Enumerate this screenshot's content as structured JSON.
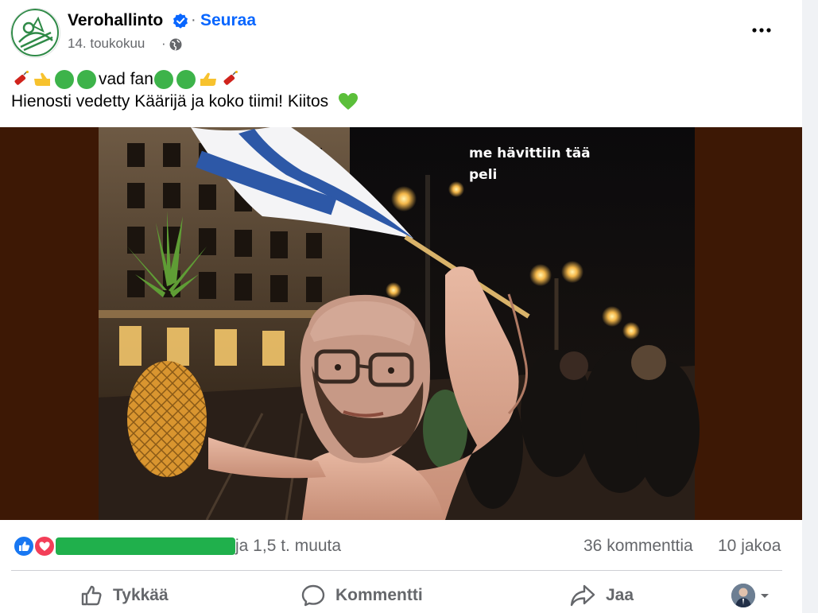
{
  "post": {
    "page_name": "Verohallinto",
    "follow_label": "Seuraa",
    "separator": "·",
    "date": "14. toukokuu",
    "date_separator": "·",
    "text_line1_word": "vad fan",
    "text_line2": "Hienosti vedetty Käärijä ja koko tiimi! Kiitos",
    "image_caption_line1": "me hävittiin tää",
    "image_caption_line2": "peli"
  },
  "stats": {
    "reactions_suffix": "ja 1,5 t. muuta",
    "comments": "36 kommenttia",
    "shares": "10 jakoa"
  },
  "actions": {
    "like": "Tykkää",
    "comment": "Kommentti",
    "share": "Jaa"
  },
  "colors": {
    "accent": "#0866ff",
    "secondary_text": "#65676b",
    "image_background": "#3d1805",
    "redaction": "#20b04c"
  },
  "icons": [
    "verified-icon",
    "globe-icon",
    "more-options-icon",
    "firecracker-icon",
    "thumb-left-icon",
    "green-circle-icon",
    "green-heart-icon",
    "like-reaction-icon",
    "love-reaction-icon",
    "like-icon",
    "comment-icon",
    "share-icon",
    "chevron-down-icon"
  ]
}
